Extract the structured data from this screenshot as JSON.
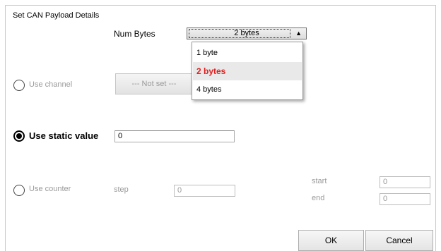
{
  "dialog": {
    "title": "Set CAN Payload Details",
    "num_bytes": {
      "label": "Num Bytes",
      "selected": "2 bytes",
      "options": [
        "1 byte",
        "2 bytes",
        "4 bytes"
      ]
    },
    "use_channel": {
      "label": "Use channel",
      "button_label": "--- Not set ---",
      "selected": false
    },
    "use_static_value": {
      "label": "Use static value",
      "value": "0",
      "selected": true
    },
    "use_counter": {
      "label": "Use counter",
      "selected": false,
      "step_label": "step",
      "step_value": "0",
      "start_label": "start",
      "start_value": "0",
      "end_label": "end",
      "end_value": "0"
    },
    "buttons": {
      "ok": "OK",
      "cancel": "Cancel"
    }
  },
  "colors": {
    "selected_option_text": "#e02020",
    "disabled_text": "#9a9a9a"
  }
}
